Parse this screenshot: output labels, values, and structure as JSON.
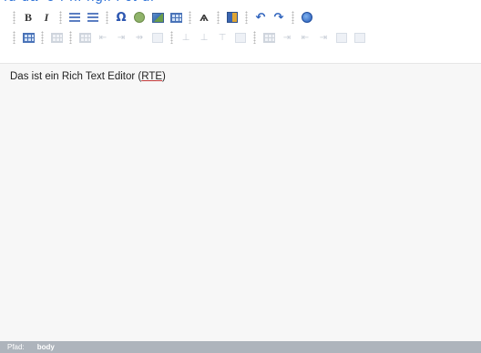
{
  "heading_fragment": "fu da  'o f  ni  ngli  l ct  di",
  "toolbar_row1": {
    "bold": "B",
    "italic": "I",
    "ordered_list": "ordered-list-icon",
    "unordered_list": "unordered-list-icon",
    "special_char": "Ω",
    "smiley": "smiley-icon",
    "image": "image-icon",
    "table": "table-icon",
    "find": "binoculars-icon",
    "spellcheck": "book-icon",
    "undo": "↶",
    "redo": "↷",
    "help": "globe-icon"
  },
  "toolbar_row2_state": "disabled",
  "content": {
    "text_before": "Das ist ein Rich Text Editor (",
    "abbr": "RTE",
    "text_after": ")"
  },
  "statusbar": {
    "label": "Pfad:",
    "path": "body"
  },
  "colors": {
    "accent_blue": "#2c56b0",
    "status_bar": "#aeb4bc",
    "content_bg": "#f7f7f7"
  }
}
